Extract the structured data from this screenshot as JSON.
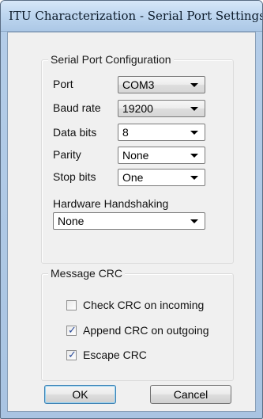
{
  "window": {
    "title": "ITU Characterization - Serial Port Settings"
  },
  "serial_config": {
    "caption": "Serial Port Configuration",
    "port": {
      "label": "Port",
      "value": "COM3"
    },
    "baud_rate": {
      "label": "Baud rate",
      "value": "19200"
    },
    "data_bits": {
      "label": "Data bits",
      "value": "8"
    },
    "parity": {
      "label": "Parity",
      "value": "None"
    },
    "stop_bits": {
      "label": "Stop bits",
      "value": "One"
    },
    "handshaking": {
      "label": "Hardware Handshaking",
      "value": "None"
    }
  },
  "message_crc": {
    "caption": "Message CRC",
    "check_incoming": {
      "label": "Check CRC on incoming",
      "checked": false
    },
    "append_outgoing": {
      "label": "Append CRC on outgoing",
      "checked": true
    },
    "escape": {
      "label": "Escape CRC",
      "checked": true
    }
  },
  "buttons": {
    "ok": "OK",
    "cancel": "Cancel"
  },
  "icons": {
    "dropdown": "chevron-down-icon",
    "check": "checkmark-icon"
  },
  "colors": {
    "titlebar": "#bfd7f0",
    "client_bg": "#f0f0f0",
    "check_mark": "#2b4c9a"
  }
}
